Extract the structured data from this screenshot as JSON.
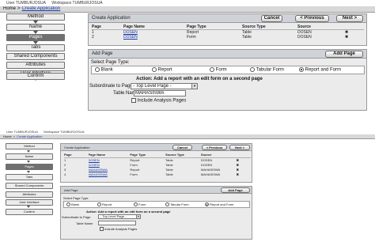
{
  "top": {
    "user_label": "User TUMBURJOSUA",
    "workspace_label": "Workspace TUMBURJOSUA",
    "breadcrumb": {
      "home": "Home",
      "current": "Create Application"
    },
    "wizard_steps": [
      "Method",
      "Name",
      "Pages",
      "Tabs",
      "Shared Components",
      "Attributes",
      "User Interface",
      "Confirm"
    ],
    "create_region": {
      "title": "Create Application",
      "cancel": "Cancel",
      "previous": "< Previous",
      "next": "Next >",
      "columns": [
        "Page",
        "Page Name",
        "Page Type",
        "Source Type",
        "Source"
      ],
      "rows": [
        {
          "page": "1",
          "name": "DOSEN",
          "type": "Report",
          "source_type": "Table",
          "source": "DOSEN"
        },
        {
          "page": "2",
          "name": "DOSEN",
          "type": "Form",
          "source_type": "Table",
          "source": "DOSEN"
        }
      ]
    },
    "add_region": {
      "title": "Add Page",
      "add_button": "Add Page",
      "select_label": "Select Page Type:",
      "options": [
        "Blank",
        "Report",
        "Form",
        "Tabular Form",
        "Report and Form"
      ],
      "action_text": "Action: Add a report with an edit form on a second page",
      "subordinate_label": "Subordinate to Page",
      "subordinate_value": "- Top Level Page -",
      "table_label": "Table Name",
      "table_value": "MAHASISWA",
      "include_label": "Include Analysis Pages"
    }
  },
  "bottom": {
    "user_label": "User TUMBURJOSUA",
    "workspace_label": "Workspace TUMBURJOSUA",
    "breadcrumb": {
      "home": "Home",
      "current": "Create Application"
    },
    "wizard_steps": [
      "Method",
      "Name",
      "Pages",
      "Tabs",
      "Shared Components",
      "Attributes",
      "User Interface",
      "Confirm"
    ],
    "create_region": {
      "title": "Create Application",
      "cancel": "Cancel",
      "previous": "< Previous",
      "next": "Next >",
      "columns": [
        "Page",
        "Page Name",
        "Page Type",
        "Source Type",
        "Source"
      ],
      "rows": [
        {
          "page": "1",
          "name": "DOSEN",
          "type": "Report",
          "source_type": "Table",
          "source": "DOSEN"
        },
        {
          "page": "2",
          "name": "DOSEN",
          "type": "Form",
          "source_type": "Table",
          "source": "DOSEN"
        },
        {
          "page": "3",
          "name": "MAHASISWA",
          "type": "Report",
          "source_type": "Table",
          "source": "MAHASISWA"
        },
        {
          "page": "4",
          "name": "MAHASISWA",
          "type": "Form",
          "source_type": "Table",
          "source": "MAHASISWA"
        }
      ]
    },
    "add_region": {
      "title": "Add Page",
      "add_button": "Add Page",
      "select_label": "Select Page Type:",
      "options": [
        "Blank",
        "Report",
        "Form",
        "Tabular Form",
        "Report and Form"
      ],
      "action_text": "Action: Add a report with an edit form on a second page",
      "subordinate_label": "Subordinate to Page",
      "subordinate_value": "- Top Level Page -",
      "table_label": "Table Name",
      "table_value": "",
      "include_label": "Include Analysis Pages"
    }
  },
  "colors": {
    "active_step": "#707070",
    "region_header": "#cfd3d8",
    "link": "#1a3aa8",
    "delete": "#cc1111"
  },
  "icons": {
    "delete": "delete-x-icon",
    "arrow": "chevron-down-icon",
    "select_arrow": "dropdown-arrow-icon"
  }
}
